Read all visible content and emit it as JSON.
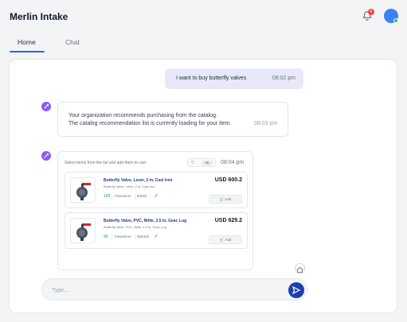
{
  "header": {
    "title": "Merlin Intake",
    "notification_count": "4"
  },
  "tabs": [
    {
      "label": "Home",
      "active": true
    },
    {
      "label": "Chat",
      "active": false
    }
  ],
  "chat": {
    "user_message": {
      "text": "I want to buy butterfly valves",
      "time": "08:02 pm"
    },
    "bot_message": {
      "line1": "Your organization recommends purchasing from the catalog.",
      "line2": "The catalog recommendation list is currently loading for your item.",
      "time": "08:03 pm"
    },
    "catalog": {
      "header": "Select items from the list and add them to cart:",
      "filter_count": "00",
      "time": "08:04 pm",
      "products": [
        {
          "name": "Butterfly Valve, Lever, 2 in, Cast Iron",
          "desc": "Butterfly Valve, Lever, 2 in, Cast Iron",
          "qty": "100",
          "supplier": "Flowserve",
          "code": "93022",
          "price": "USD 600.2",
          "add_label": "Add"
        },
        {
          "name": "Butterfly Valve, PVC, Nitile, 2.5 in, Gear, Lug",
          "desc": "Butterfly Valve, PVC, Nitile, 2.5 in, Gear, Lug",
          "qty": "96",
          "supplier": "Flowserve",
          "code": "859425",
          "price": "USD 629.2",
          "add_label": "Add"
        }
      ]
    }
  },
  "composer": {
    "placeholder": "Type..."
  },
  "colors": {
    "accent": "#2563eb",
    "bot_icon": "#8b5cf6",
    "send_button": "#1e40af",
    "user_bubble": "#e8e9f8",
    "notification_badge": "#ef4444"
  },
  "icons": [
    "bell-icon",
    "avatar",
    "bot-icon",
    "filter-icon",
    "external-link-icon",
    "cart-icon",
    "home-icon",
    "send-icon"
  ]
}
